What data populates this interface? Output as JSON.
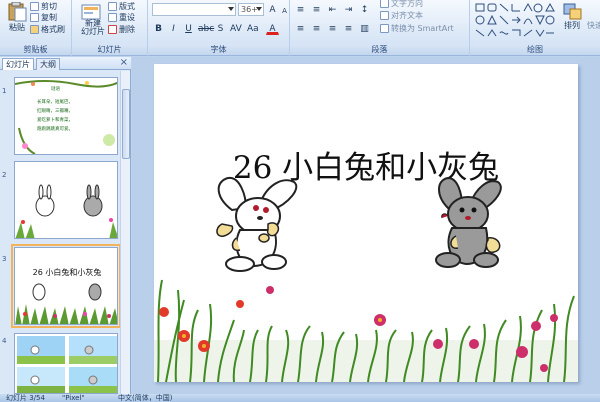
{
  "ribbon": {
    "clipboard": {
      "label": "剪贴板",
      "paste": "粘贴",
      "cut": "剪切",
      "copy": "复制",
      "format_painter": "格式刷"
    },
    "slides": {
      "label": "幻灯片",
      "new_slide": "新建\n幻灯片",
      "layout": "版式",
      "reset": "重设",
      "delete": "删除"
    },
    "font": {
      "label": "字体",
      "font_name": "",
      "font_size": "36+"
    },
    "paragraph": {
      "label": "段落",
      "text_direction": "文字方向",
      "align_text": "对齐文本",
      "smartart": "转换为 SmartArt"
    },
    "drawing": {
      "label": "绘图",
      "arrange": "排列",
      "quick_styles": "快速"
    }
  },
  "panel": {
    "tab_slides": "幻灯片",
    "tab_outline": "大纲",
    "close": "×",
    "thumbs": [
      {
        "num": "1",
        "lines": [
          "谜语",
          "长耳朵，短尾巴，",
          "红眼睛，三瓣嘴，",
          "爱吃萝卜和青菜，",
          "跑跑跳跳真可爱。"
        ]
      },
      {
        "num": "2"
      },
      {
        "num": "3",
        "title": "26 小白兔和小灰兔"
      },
      {
        "num": "4"
      }
    ]
  },
  "slide": {
    "title": "26  小白兔和小灰兔"
  },
  "status": {
    "slide_info": "幻灯片 3/54",
    "theme": "\"Pixel\"",
    "language": "中文(简体，中国)"
  },
  "colors": {
    "ribbon_bg": "#dde9f7",
    "workspace_bg": "#b9cfea",
    "selection": "#f2b35a"
  }
}
